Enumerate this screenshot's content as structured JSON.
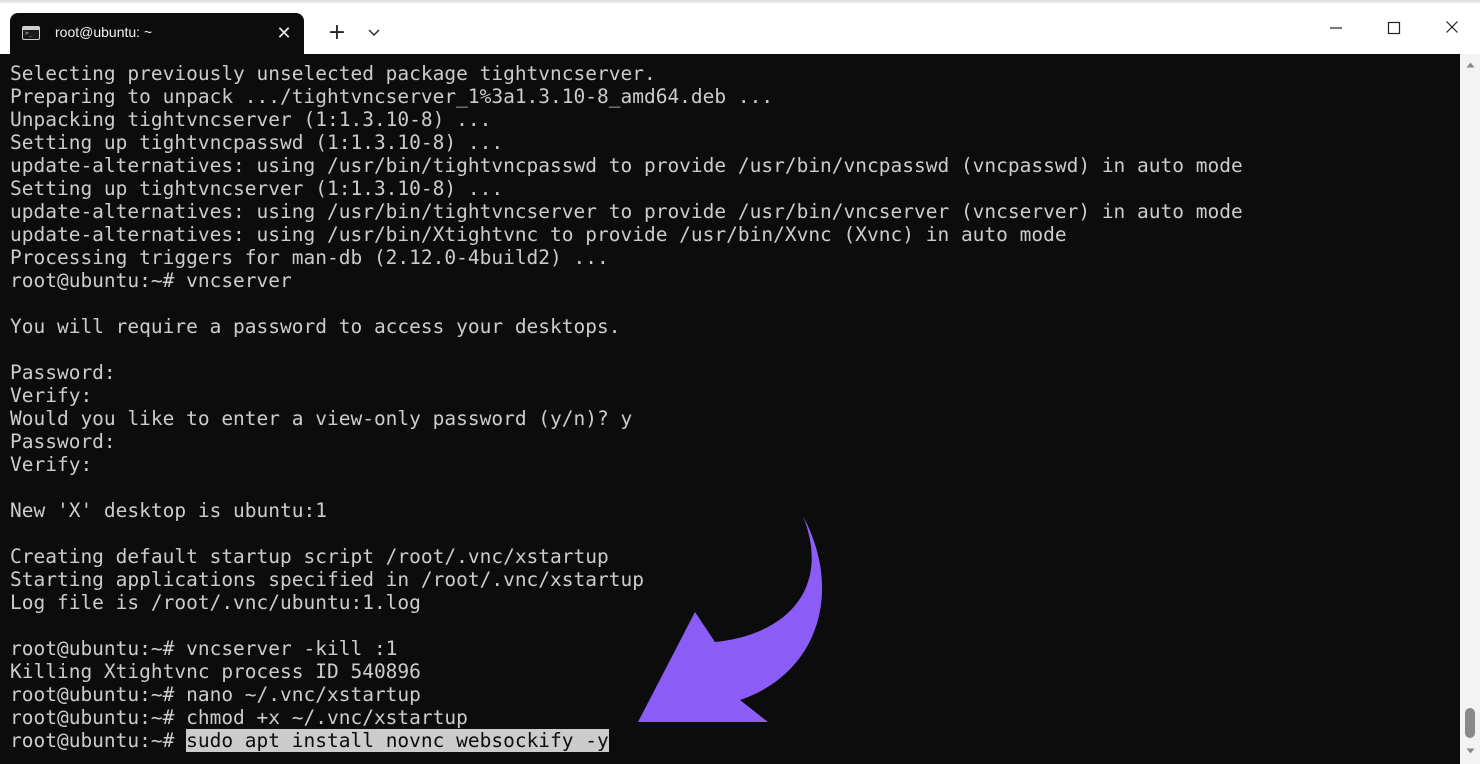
{
  "window": {
    "tab_title": "root@ubuntu: ~",
    "icons": {
      "terminal": "terminal-icon",
      "close_tab": "close-icon",
      "new_tab": "plus-icon",
      "dropdown": "chevron-down-icon",
      "minimize": "minimize-icon",
      "maximize": "maximize-icon",
      "close_window": "close-icon"
    },
    "glyphs": {
      "close_tab": "✕",
      "new_tab": "+",
      "dropdown": "⌄",
      "minimize": "—",
      "maximize": "☐",
      "close_window": "✕"
    }
  },
  "terminal": {
    "prompt": "root@ubuntu:~# ",
    "lines": [
      "Selecting previously unselected package tightvncserver.",
      "Preparing to unpack .../tightvncserver_1%3a1.3.10-8_amd64.deb ...",
      "Unpacking tightvncserver (1:1.3.10-8) ...",
      "Setting up tightvncpasswd (1:1.3.10-8) ...",
      "update-alternatives: using /usr/bin/tightvncpasswd to provide /usr/bin/vncpasswd (vncpasswd) in auto mode",
      "Setting up tightvncserver (1:1.3.10-8) ...",
      "update-alternatives: using /usr/bin/tightvncserver to provide /usr/bin/vncserver (vncserver) in auto mode",
      "update-alternatives: using /usr/bin/Xtightvnc to provide /usr/bin/Xvnc (Xvnc) in auto mode",
      "Processing triggers for man-db (2.12.0-4build2) ...",
      "root@ubuntu:~# vncserver",
      "",
      "You will require a password to access your desktops.",
      "",
      "Password:",
      "Verify:",
      "Would you like to enter a view-only password (y/n)? y",
      "Password:",
      "Verify:",
      "",
      "New 'X' desktop is ubuntu:1",
      "",
      "Creating default startup script /root/.vnc/xstartup",
      "Starting applications specified in /root/.vnc/xstartup",
      "Log file is /root/.vnc/ubuntu:1.log",
      "",
      "root@ubuntu:~# vncserver -kill :1",
      "Killing Xtightvnc process ID 540896",
      "root@ubuntu:~# nano ~/.vnc/xstartup",
      "root@ubuntu:~# chmod +x ~/.vnc/xstartup"
    ],
    "current_command": "sudo apt install novnc websockify -y"
  },
  "colors": {
    "background": "#0c0c0c",
    "foreground": "#cccccc",
    "selection": "#cccccc",
    "annotation_arrow": "#8b5cf6"
  }
}
